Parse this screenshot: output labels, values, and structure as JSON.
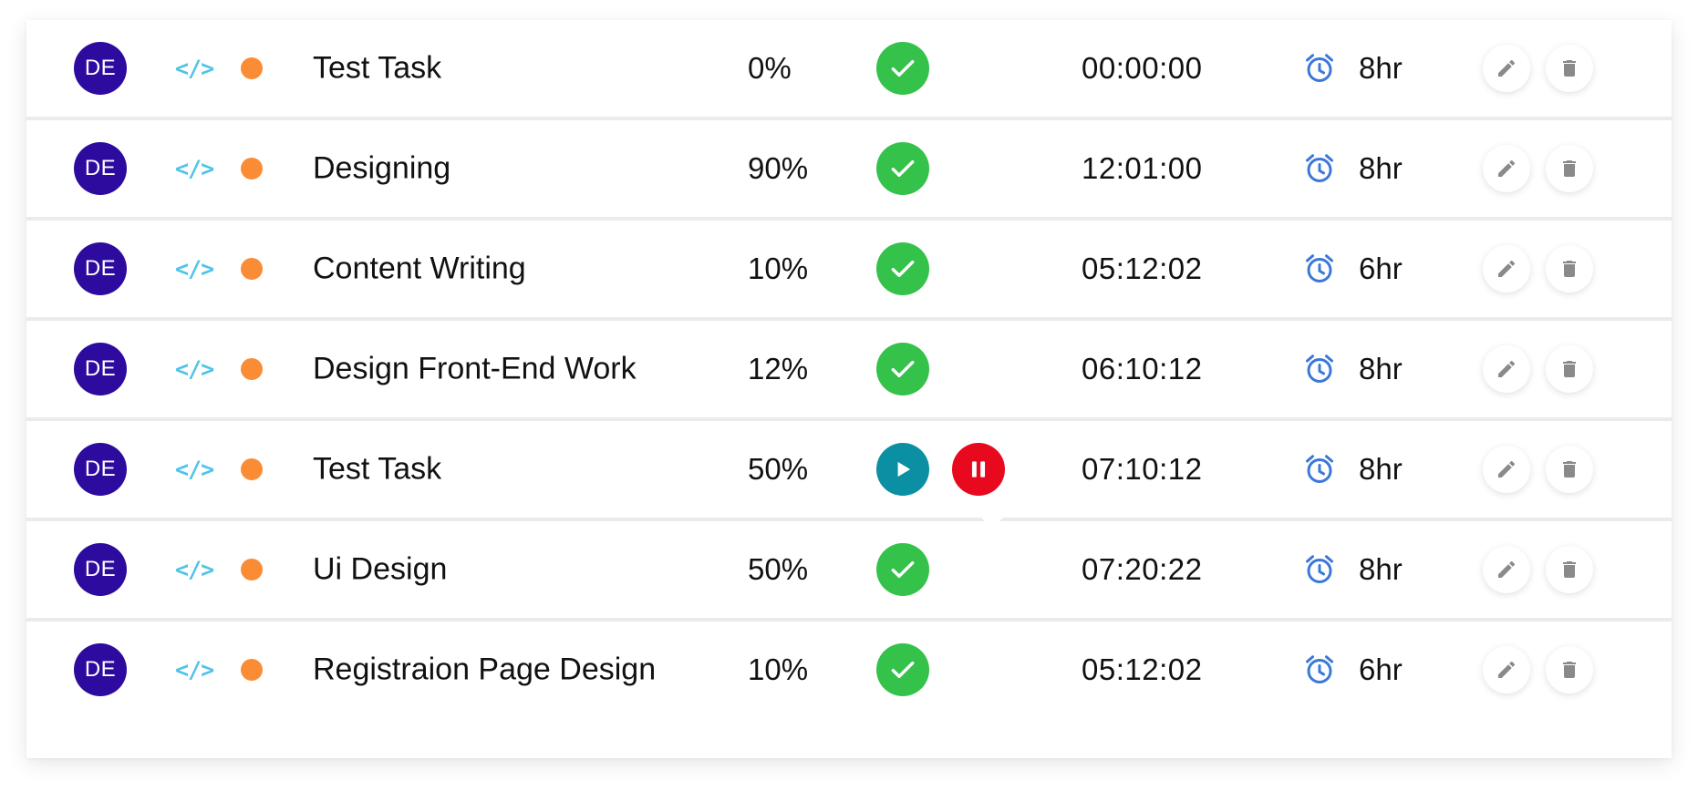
{
  "avatar_initials": "DE",
  "code_glyph": "</>",
  "colors": {
    "avatar": "#2d0b9e",
    "code": "#4fc3e8",
    "dot": "#fb8c36",
    "done": "#34c24b",
    "play": "#0b8fa3",
    "pause": "#e8091f",
    "alarm": "#3b78d8"
  },
  "tasks": [
    {
      "name": "Test Task",
      "progress": "0%",
      "status": "done",
      "timer": "00:00:00",
      "hours": "8hr"
    },
    {
      "name": "Designing",
      "progress": "90%",
      "status": "done",
      "timer": "12:01:00",
      "hours": "8hr"
    },
    {
      "name": "Content Writing",
      "progress": "10%",
      "status": "done",
      "timer": "05:12:02",
      "hours": "6hr"
    },
    {
      "name": "Design Front-End Work",
      "progress": "12%",
      "status": "done",
      "timer": "06:10:12",
      "hours": "8hr"
    },
    {
      "name": "Test Task",
      "progress": "50%",
      "status": "running",
      "timer": "07:10:12",
      "hours": "8hr"
    },
    {
      "name": "Ui Design",
      "progress": "50%",
      "status": "done",
      "timer": "07:20:22",
      "hours": "8hr"
    },
    {
      "name": "Registraion Page Design",
      "progress": "10%",
      "status": "done",
      "timer": "05:12:02",
      "hours": "6hr"
    }
  ]
}
